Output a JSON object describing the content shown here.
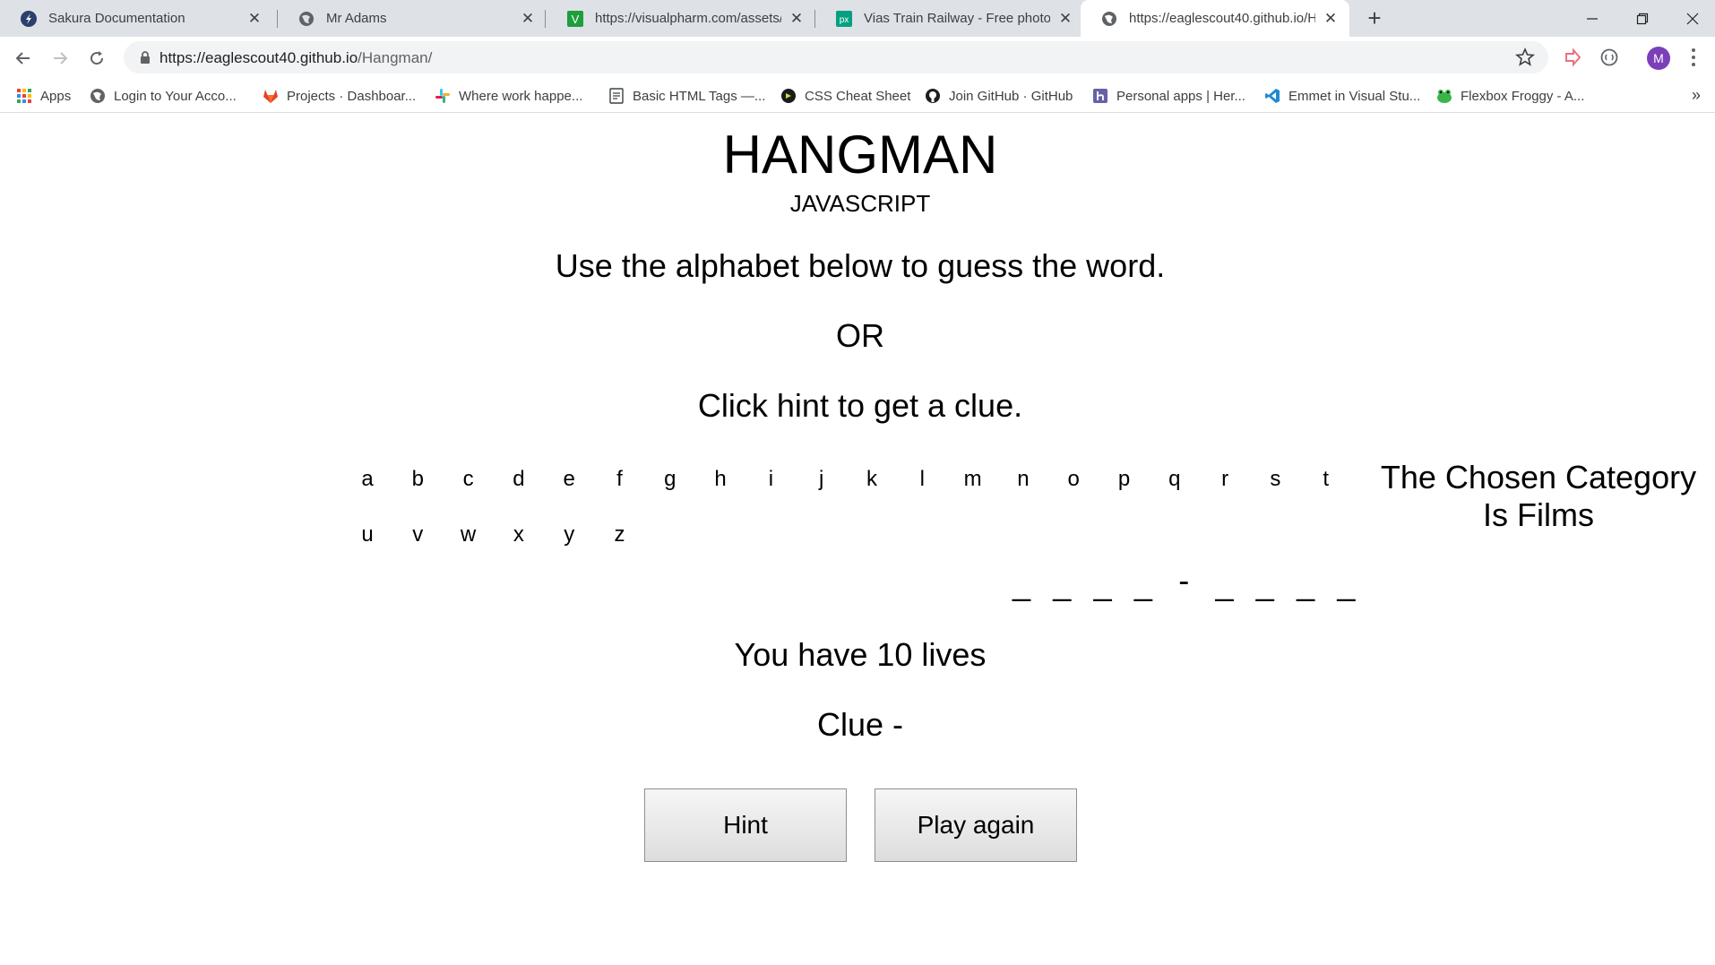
{
  "browser": {
    "tabs": [
      {
        "title": "Sakura Documentation",
        "icon": "sakura-icon"
      },
      {
        "title": "Mr Adams",
        "icon": "globe-icon"
      },
      {
        "title": "https://visualpharm.com/assets/",
        "icon": "visualpharm-icon"
      },
      {
        "title": "Vias Train Railway - Free photo o",
        "icon": "pexels-icon"
      },
      {
        "title": "https://eaglescout40.github.io/H",
        "icon": "globe-icon",
        "active": true
      }
    ],
    "address": {
      "host": "https://eaglescout40.github.io",
      "path": "/Hangman/"
    },
    "avatar_letter": "M",
    "bookmarks": [
      {
        "label": "Apps",
        "icon": "apps-grid-icon"
      },
      {
        "label": "Login to Your Acco...",
        "icon": "globe-icon"
      },
      {
        "label": "Projects · Dashboar...",
        "icon": "gitlab-icon"
      },
      {
        "label": "Where work happe...",
        "icon": "slack-icon"
      },
      {
        "label": "Basic HTML Tags —...",
        "icon": "document-icon"
      },
      {
        "label": "CSS Cheat Sheet",
        "icon": "css-icon"
      },
      {
        "label": "Join GitHub · GitHub",
        "icon": "github-icon"
      },
      {
        "label": "Personal apps | Her...",
        "icon": "heroku-icon"
      },
      {
        "label": "Emmet in Visual Stu...",
        "icon": "vscode-icon"
      },
      {
        "label": "Flexbox Froggy - A...",
        "icon": "frog-icon"
      }
    ],
    "bookmarks_more": "»"
  },
  "page": {
    "title": "HANGMAN",
    "subtitle": "JAVASCRIPT",
    "instruction_1": "Use the alphabet below to guess the word.",
    "instruction_or": "OR",
    "instruction_2": "Click hint to get a clue.",
    "alphabet": [
      "a",
      "b",
      "c",
      "d",
      "e",
      "f",
      "g",
      "h",
      "i",
      "j",
      "k",
      "l",
      "m",
      "n",
      "o",
      "p",
      "q",
      "r",
      "s",
      "t",
      "u",
      "v",
      "w",
      "x",
      "y",
      "z"
    ],
    "category_line_1": "The Chosen Category",
    "category_line_2": "Is Films",
    "word_slots": [
      "_",
      "_",
      "_",
      "_",
      "-",
      "_",
      "_",
      "_",
      "_"
    ],
    "lives": "You have 10 lives",
    "clue": "Clue -",
    "hint_button": "Hint",
    "reset_button": "Play again"
  }
}
